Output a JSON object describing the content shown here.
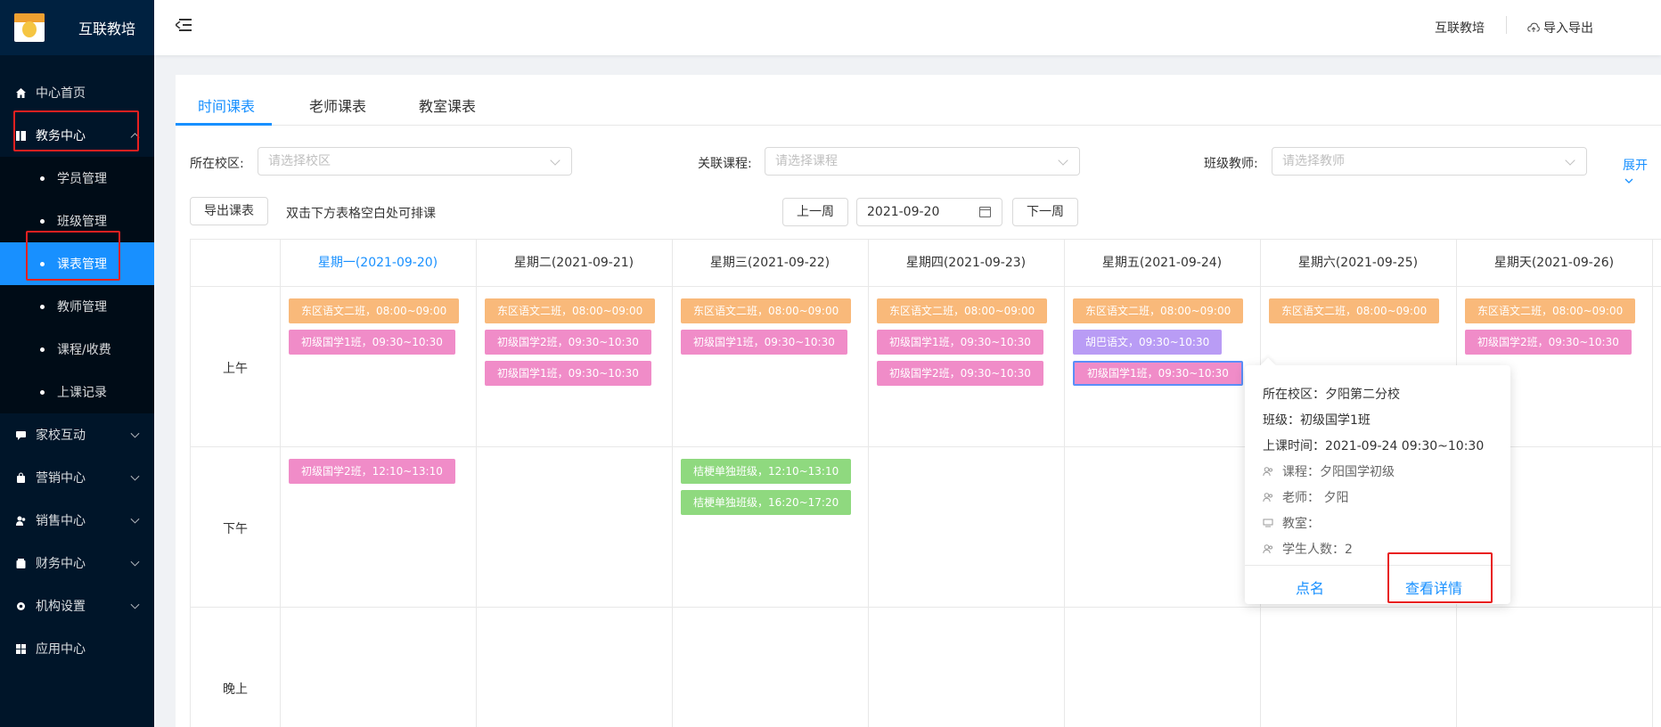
{
  "app": {
    "logo_text": "互联教培",
    "logo_caption": "互联教培"
  },
  "sidebar": {
    "items": [
      {
        "label": "中心首页",
        "icon": "home-icon"
      },
      {
        "label": "教务中心",
        "icon": "book-icon",
        "expanded": true,
        "children": [
          {
            "label": "学员管理"
          },
          {
            "label": "班级管理"
          },
          {
            "label": "课表管理",
            "active": true
          },
          {
            "label": "教师管理"
          },
          {
            "label": "课程/收费"
          },
          {
            "label": "上课记录"
          }
        ]
      },
      {
        "label": "家校互动",
        "icon": "chat-icon"
      },
      {
        "label": "营销中心",
        "icon": "bag-icon"
      },
      {
        "label": "销售中心",
        "icon": "users-icon"
      },
      {
        "label": "财务中心",
        "icon": "wallet-icon"
      },
      {
        "label": "机构设置",
        "icon": "gear-icon"
      },
      {
        "label": "应用中心",
        "icon": "apps-icon"
      }
    ]
  },
  "header": {
    "org_name": "互联教培",
    "import_export": "导入导出"
  },
  "tabs": [
    {
      "label": "时间课表",
      "active": true
    },
    {
      "label": "老师课表"
    },
    {
      "label": "教室课表"
    }
  ],
  "filters": {
    "campus_label": "所在校区:",
    "campus_placeholder": "请选择校区",
    "course_label": "关联课程:",
    "course_placeholder": "请选择课程",
    "teacher_label": "班级教师:",
    "teacher_placeholder": "请选择教师",
    "expand": "展开"
  },
  "toolbar": {
    "export_label": "导出课表",
    "hint": "双击下方表格空白处可排课",
    "prev_week": "上一周",
    "date": "2021-09-20",
    "next_week": "下一周"
  },
  "schedule": {
    "days": [
      "星期一(2021-09-20)",
      "星期二(2021-09-21)",
      "星期三(2021-09-22)",
      "星期四(2021-09-23)",
      "星期五(2021-09-24)",
      "星期六(2021-09-25)",
      "星期天(2021-09-26)"
    ],
    "today_index": 0,
    "periods": [
      "上午",
      "下午",
      "晚上"
    ],
    "lessons": [
      {
        "day": 0,
        "period": 0,
        "slot": 0,
        "text": "东区语文二班，08:00~09:00",
        "color": "orange"
      },
      {
        "day": 0,
        "period": 0,
        "slot": 1,
        "text": "初级国学1班，09:30~10:30",
        "color": "pink"
      },
      {
        "day": 1,
        "period": 0,
        "slot": 0,
        "text": "东区语文二班，08:00~09:00",
        "color": "orange"
      },
      {
        "day": 1,
        "period": 0,
        "slot": 1,
        "text": "初级国学2班，09:30~10:30",
        "color": "pink"
      },
      {
        "day": 1,
        "period": 0,
        "slot": 2,
        "text": "初级国学1班，09:30~10:30",
        "color": "pink"
      },
      {
        "day": 2,
        "period": 0,
        "slot": 0,
        "text": "东区语文二班，08:00~09:00",
        "color": "orange"
      },
      {
        "day": 2,
        "period": 0,
        "slot": 1,
        "text": "初级国学1班，09:30~10:30",
        "color": "pink"
      },
      {
        "day": 3,
        "period": 0,
        "slot": 0,
        "text": "东区语文二班，08:00~09:00",
        "color": "orange"
      },
      {
        "day": 3,
        "period": 0,
        "slot": 1,
        "text": "初级国学1班，09:30~10:30",
        "color": "pink"
      },
      {
        "day": 3,
        "period": 0,
        "slot": 2,
        "text": "初级国学2班，09:30~10:30",
        "color": "pink"
      },
      {
        "day": 4,
        "period": 0,
        "slot": 0,
        "text": "东区语文二班，08:00~09:00",
        "color": "orange"
      },
      {
        "day": 4,
        "period": 0,
        "slot": 1,
        "text": "胡巴语文，09:30~10:30",
        "color": "purple"
      },
      {
        "day": 4,
        "period": 0,
        "slot": 2,
        "text": "初级国学1班，09:30~10:30",
        "color": "pink",
        "selected": true
      },
      {
        "day": 5,
        "period": 0,
        "slot": 0,
        "text": "东区语文二班，08:00~09:00",
        "color": "orange"
      },
      {
        "day": 6,
        "period": 0,
        "slot": 0,
        "text": "东区语文二班，08:00~09:00",
        "color": "orange"
      },
      {
        "day": 6,
        "period": 0,
        "slot": 1,
        "text": "初级国学2班，09:30~10:30",
        "color": "pink"
      },
      {
        "day": 0,
        "period": 1,
        "slot": 0,
        "text": "初级国学2班，12:10~13:10",
        "color": "pink"
      },
      {
        "day": 2,
        "period": 1,
        "slot": 0,
        "text": "桔梗单独班级，12:10~13:10",
        "color": "green"
      },
      {
        "day": 2,
        "period": 1,
        "slot": 1,
        "text": "桔梗单独班级，16:20~17:20",
        "color": "green"
      }
    ],
    "colors": {
      "orange": "#f9b97a",
      "pink": "#f08cc8",
      "purple": "#b99cf5",
      "green": "#8fd97f"
    }
  },
  "popover": {
    "campus": "所在校区：夕阳第二分校",
    "class": "班级：初级国学1班",
    "time": "上课时间：2021-09-24 09:30~10:30",
    "course": "课程：夕阳国学初级",
    "teacher": "老师： 夕阳",
    "room": "教室：",
    "students": "学生人数：2",
    "roll_call": "点名",
    "view_detail": "查看详情"
  },
  "accent_color": "#1890ff",
  "sidebar_bg": "#001529"
}
